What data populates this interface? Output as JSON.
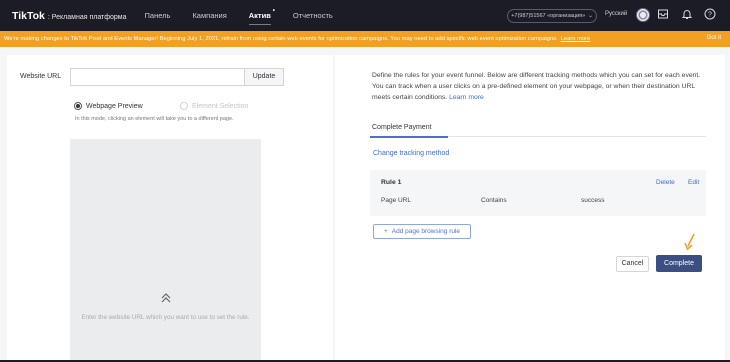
{
  "header": {
    "brand": "TikTok",
    "brand_sub": ": Рекламная платформа",
    "nav": [
      {
        "label": "Панель"
      },
      {
        "label": "Кампания"
      },
      {
        "label": "Актив"
      },
      {
        "label": "Отчетность"
      }
    ],
    "account": "+7(987)51567 «организация»",
    "language": "Русский",
    "icons": [
      "avatar-icon",
      "mailbox-icon",
      "bell-icon",
      "help-icon"
    ]
  },
  "banner": {
    "text": "We're making changes to TikTok Pixel and Events Manager! Beginning July 1, 2021, refrain from using certain web events for optimization campaigns. You may need to add specific web event optimization campaigns.",
    "learn_more": "Learn more",
    "got_it": "Got it",
    "color": "#f2a024"
  },
  "left": {
    "url_label": "Website URL",
    "url_value": "",
    "update_label": "Update",
    "radio_preview": "Webpage Preview",
    "radio_selection": "Element Selection",
    "hint": "In this mode, clicking an element will take you to a different page.",
    "preview_text": "Enter the website URL which you want to use to set the rule."
  },
  "right": {
    "description": "Define the rules for your event funnel. Below are different tracking methods which you can set for each event. You can track when a user clicks on a pre-defined element on your webpage, or when their destination URL meets certain conditions.",
    "learn_more": "Learn more",
    "tab": "Complete Payment",
    "change_method": "Change tracking method",
    "rule": {
      "title": "Rule 1",
      "delete": "Delete",
      "edit": "Edit",
      "field": "Page URL",
      "operator": "Contains",
      "value": "success"
    },
    "add_rule": "Add page browsing rule",
    "cancel": "Cancel",
    "complete": "Complete"
  },
  "colors": {
    "accent": "#3c6cd0",
    "primary_button": "#3b4f83",
    "nav_bg": "#1b1c26"
  }
}
